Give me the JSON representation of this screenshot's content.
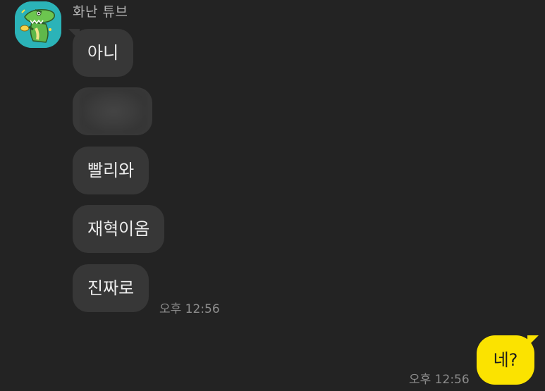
{
  "conversation": {
    "sender_name": "화난 튜브",
    "incoming": [
      {
        "text": "아니"
      },
      {
        "text": ""
      },
      {
        "text": "빨리와"
      },
      {
        "text": "재혁이옴"
      },
      {
        "text": "진짜로"
      }
    ],
    "incoming_time": "오후 12:56",
    "outgoing": [
      {
        "text": "네?"
      }
    ],
    "outgoing_time": "오후 12:56"
  },
  "icons": {
    "avatar": "angry-tube-crocodile-avatar-icon"
  },
  "colors": {
    "background": "#232323",
    "incoming_bubble": "#373737",
    "outgoing_bubble": "#fbe300",
    "avatar_background": "#2bb3b8"
  }
}
